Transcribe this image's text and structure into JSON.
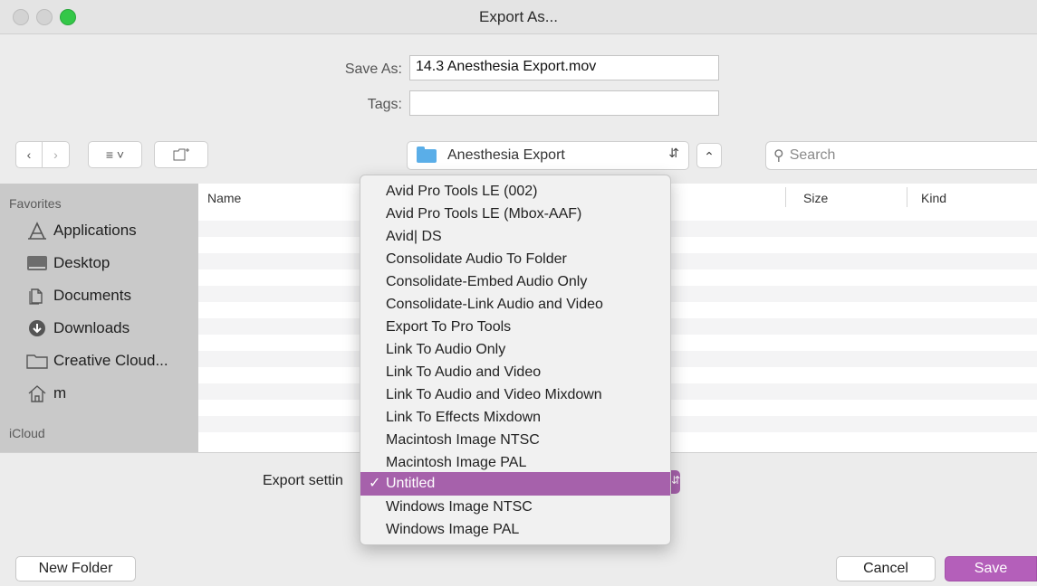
{
  "window": {
    "title": "Export As..."
  },
  "form": {
    "save_as_label": "Save As:",
    "save_as_value": "14.3 Anesthesia Export.mov",
    "tags_label": "Tags:",
    "tags_value": ""
  },
  "toolbar": {
    "back_icon": "chevron-left-icon",
    "forward_icon": "chevron-right-icon",
    "view_icon": "list-view-icon",
    "new_folder_icon": "new-folder-icon",
    "location": "Anesthesia Export",
    "search_placeholder": "Search"
  },
  "sidebar": {
    "favorites_header": "Favorites",
    "items": [
      {
        "label": "Applications",
        "icon": "applications-icon"
      },
      {
        "label": "Desktop",
        "icon": "desktop-icon"
      },
      {
        "label": "Documents",
        "icon": "documents-icon"
      },
      {
        "label": "Downloads",
        "icon": "downloads-icon"
      },
      {
        "label": "Creative Cloud...",
        "icon": "folder-icon"
      },
      {
        "label": "m",
        "icon": "home-icon"
      }
    ],
    "icloud_header": "iCloud"
  },
  "list": {
    "columns": {
      "name": "Name",
      "size": "Size",
      "kind": "Kind"
    }
  },
  "export": {
    "label": "Export settin",
    "menu_items": [
      "Avid Pro Tools LE (002)",
      "Avid Pro Tools LE (Mbox-AAF)",
      "Avid| DS",
      "Consolidate Audio To Folder",
      "Consolidate-Embed Audio Only",
      "Consolidate-Link Audio and Video",
      "Export To Pro Tools",
      "Link To Audio Only",
      "Link To Audio and Video",
      "Link To Audio and Video Mixdown",
      "Link To Effects Mixdown",
      "Macintosh Image NTSC",
      "Macintosh Image PAL",
      "Untitled",
      "Windows Image NTSC",
      "Windows Image PAL"
    ],
    "selected": "Untitled",
    "check": "✓"
  },
  "buttons": {
    "new_folder": "New Folder",
    "cancel": "Cancel",
    "save": "Save"
  },
  "colors": {
    "accent": "#a661ab",
    "save_button": "#b45fba"
  }
}
